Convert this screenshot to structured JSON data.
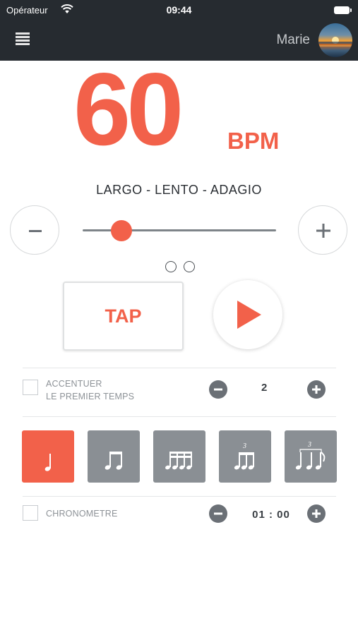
{
  "status_bar": {
    "carrier": "Opérateur",
    "time": "09:44"
  },
  "header": {
    "user_name": "Marie",
    "menu_icon": "hamburger-menu-icon",
    "avatar_icon": "sunset-avatar"
  },
  "metronome": {
    "bpm": "60",
    "bpm_unit": "BPM",
    "tempo_name": "LARGO - LENTO - ADAGIO",
    "slider_fraction": 0.2,
    "tap_label": "TAP",
    "pages": 2
  },
  "accent": {
    "label_line1": "ACCENTUER",
    "label_line2": "LE PREMIER TEMPS",
    "value": "2",
    "checked": false
  },
  "subdivisions": [
    {
      "name": "quarter-note",
      "active": true
    },
    {
      "name": "eighth-notes",
      "active": false
    },
    {
      "name": "sixteenth-notes",
      "active": false
    },
    {
      "name": "triplet-eighths",
      "active": false
    },
    {
      "name": "triplet-quarter-eighth",
      "active": false
    }
  ],
  "chronometer": {
    "label": "CHRONOMETRE",
    "value": "01 : 00",
    "checked": false
  },
  "colors": {
    "accent": "#f2614a",
    "header": "#262b30",
    "button_gray": "#8a8f94",
    "text": "#3a3f44"
  }
}
